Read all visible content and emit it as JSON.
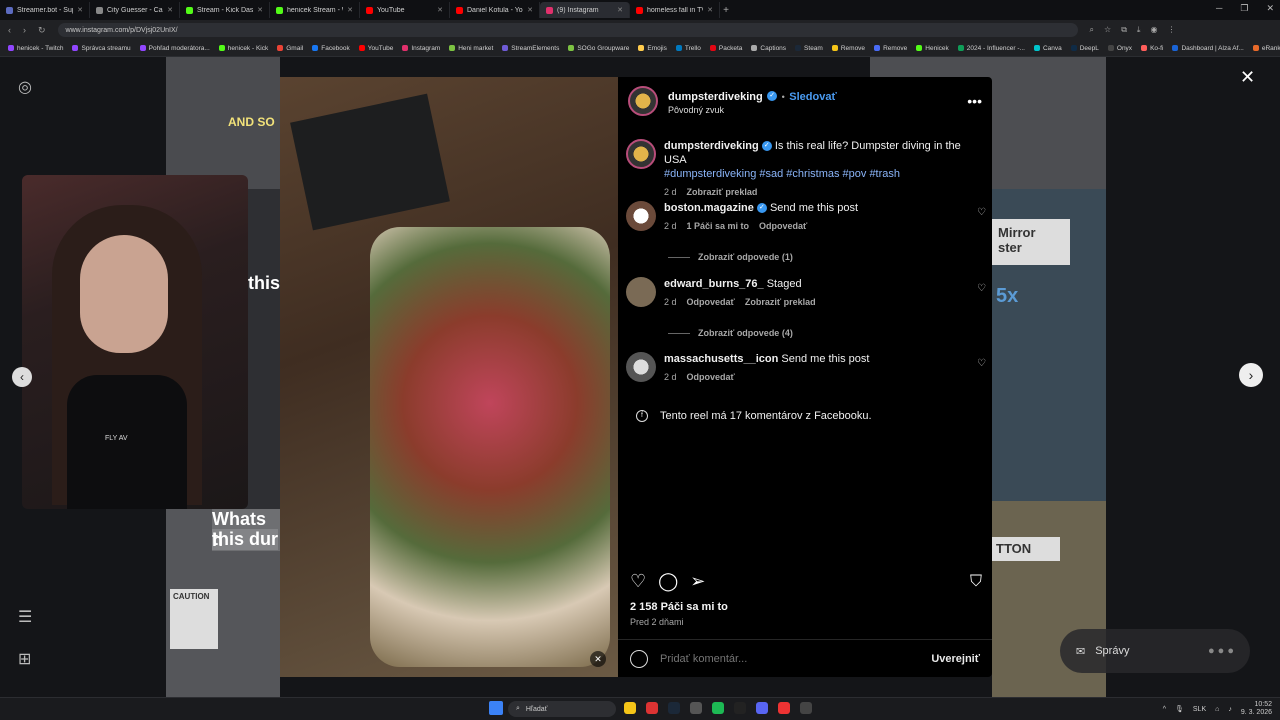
{
  "browser": {
    "tabs": [
      {
        "title": "Streamer.bot - Superchat",
        "color": "#5c6bc0",
        "active": false
      },
      {
        "title": "City Guesser - Can you guess",
        "color": "#888888",
        "active": false
      },
      {
        "title": "Stream - Kick Dashboard",
        "color": "#53fc18",
        "active": false
      },
      {
        "title": "henicek Stream - Watch Li",
        "color": "#53fc18",
        "active": false
      },
      {
        "title": "YouTube",
        "color": "#ff0000",
        "active": false
      },
      {
        "title": "Daniel Kotula - YouTube",
        "color": "#ff0000",
        "active": false
      },
      {
        "title": "(9) Instagram",
        "color": "#e1306c",
        "active": true
      },
      {
        "title": "homeless fall in TV-falls in",
        "color": "#ff0000",
        "active": false
      }
    ],
    "url": "www.instagram.com/p/DVjsj02UnIX/",
    "bookmarks": [
      {
        "label": "henicek - Twitch",
        "color": "#9146ff"
      },
      {
        "label": "Správca streamu",
        "color": "#9146ff"
      },
      {
        "label": "Pohľad moderátora...",
        "color": "#9146ff"
      },
      {
        "label": "henicek - Kick",
        "color": "#53fc18"
      },
      {
        "label": "Gmail",
        "color": "#ea4335"
      },
      {
        "label": "Facebook",
        "color": "#1877f2"
      },
      {
        "label": "YouTube",
        "color": "#ff0000"
      },
      {
        "label": "Instagram",
        "color": "#e1306c"
      },
      {
        "label": "Heni market",
        "color": "#7cc242"
      },
      {
        "label": "StreamElements",
        "color": "#6f5bd6"
      },
      {
        "label": "SOGo Groupware",
        "color": "#7cc242"
      },
      {
        "label": "Emojis",
        "color": "#ffcc4d"
      },
      {
        "label": "Trello",
        "color": "#0079bf"
      },
      {
        "label": "Packeta",
        "color": "#e30613"
      },
      {
        "label": "Captions",
        "color": "#aaaaaa"
      },
      {
        "label": "Steam",
        "color": "#1b2838"
      },
      {
        "label": "Remove",
        "color": "#f5c518"
      },
      {
        "label": "Remove",
        "color": "#4a6cf7"
      },
      {
        "label": "Henicek",
        "color": "#53fc18"
      },
      {
        "label": "2024 - Influencer -...",
        "color": "#0f9d58"
      },
      {
        "label": "Canva",
        "color": "#00c4cc"
      },
      {
        "label": "DeepL",
        "color": "#0f2b46"
      },
      {
        "label": "Onyx",
        "color": "#444444"
      },
      {
        "label": "Ko-fi",
        "color": "#ff5e5b"
      },
      {
        "label": "Dashboard | Alza Af...",
        "color": "#1a64d6"
      },
      {
        "label": "eRank",
        "color": "#e86a2a"
      },
      {
        "label": "Etsy",
        "color": "#f56400"
      }
    ]
  },
  "post": {
    "author": "dumpsterdiveking",
    "follow_label": "Sledovať",
    "audio_label": "Pôvodný zvuk",
    "caption": {
      "author": "dumpsterdiveking",
      "text": "Is this real life? Dumpster diving in the USA",
      "hashtags": "#dumpsterdiveking #sad #christmas #pov #trash",
      "time": "2 d",
      "translate": "Zobraziť preklad"
    },
    "comments": [
      {
        "author": "boston.magazine",
        "verified": true,
        "text": "Send me this post",
        "time": "2 d",
        "likes": "1 Páči sa mi to",
        "reply": "Odpovedať",
        "replies_label": "Zobraziť odpovede (1)"
      },
      {
        "author": "edward_burns_76_",
        "verified": false,
        "text": "Staged",
        "time": "2 d",
        "reply": "Odpovedať",
        "translate": "Zobraziť preklad",
        "replies_label": "Zobraziť odpovede (4)"
      },
      {
        "author": "massachusetts__icon",
        "verified": false,
        "text": "Send me this post",
        "time": "2 d",
        "reply": "Odpovedať"
      }
    ],
    "facebook_note": "Tento reel má 17 komentárov z Facebooku.",
    "likes": "2 158 Páči sa mi to",
    "posted_ago": "Pred 2 dňami",
    "comment_placeholder": "Pridať komentár...",
    "post_button": "Uverejniť"
  },
  "page": {
    "messages_label": "Správy",
    "video_overlay_texts": [
      "AND SO",
      "this",
      "Whats h",
      "this dur",
      "Mirror",
      "ster",
      "5x",
      "TTON",
      "CAUTION"
    ]
  },
  "webcam": {
    "shirt_text": "FLY AV"
  },
  "taskbar": {
    "search_label": "Hľadať",
    "language": "SLK",
    "time": "10:52",
    "date": "9. 3. 2026"
  }
}
